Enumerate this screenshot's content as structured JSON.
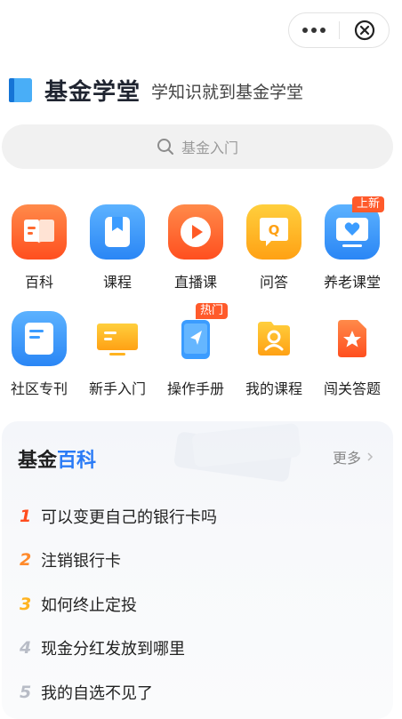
{
  "app": {
    "title": "基金学堂",
    "subtitle": "学知识就到基金学堂"
  },
  "capsule": {
    "more_icon": "ellipsis-icon",
    "close_icon": "close-circle-icon"
  },
  "search": {
    "placeholder": "基金入门",
    "icon": "search-icon"
  },
  "grid": {
    "row1": [
      {
        "label": "百科",
        "icon": "book-icon",
        "color": "#ff6a2f"
      },
      {
        "label": "课程",
        "icon": "bookmark-icon",
        "color": "#3b9cff"
      },
      {
        "label": "直播课",
        "icon": "play-icon",
        "color": "#ff6a2f"
      },
      {
        "label": "问答",
        "icon": "qa-bubble-icon",
        "color": "#ffb320"
      },
      {
        "label": "养老课堂",
        "icon": "heart-screen-icon",
        "color": "#3b9cff",
        "tag": "上新"
      }
    ],
    "row2": [
      {
        "label": "社区专刊",
        "icon": "document-icon",
        "color": "#3b9cff"
      },
      {
        "label": "新手入门",
        "icon": "monitor-icon",
        "color": "#ffb320"
      },
      {
        "label": "操作手册",
        "icon": "phone-arrow-icon",
        "color": "#3b9cff",
        "tag": "热门"
      },
      {
        "label": "我的课程",
        "icon": "folder-user-icon",
        "color": "#ffb320"
      },
      {
        "label": "闯关答题",
        "icon": "star-file-icon",
        "color": "#ff6a2f"
      }
    ]
  },
  "encyclopedia": {
    "title_a": "基金",
    "title_b": "百科",
    "more": "更多",
    "items": [
      {
        "num": "1",
        "text": "可以变更自己的银行卡吗",
        "color": "#ff4d1f"
      },
      {
        "num": "2",
        "text": "注销银行卡",
        "color": "#ff8a2b"
      },
      {
        "num": "3",
        "text": "如何终止定投",
        "color": "#ffb320"
      },
      {
        "num": "4",
        "text": "现金分红发放到哪里",
        "color": "#b8bcc6"
      },
      {
        "num": "5",
        "text": "我的自选不见了",
        "color": "#b8bcc6"
      }
    ]
  }
}
